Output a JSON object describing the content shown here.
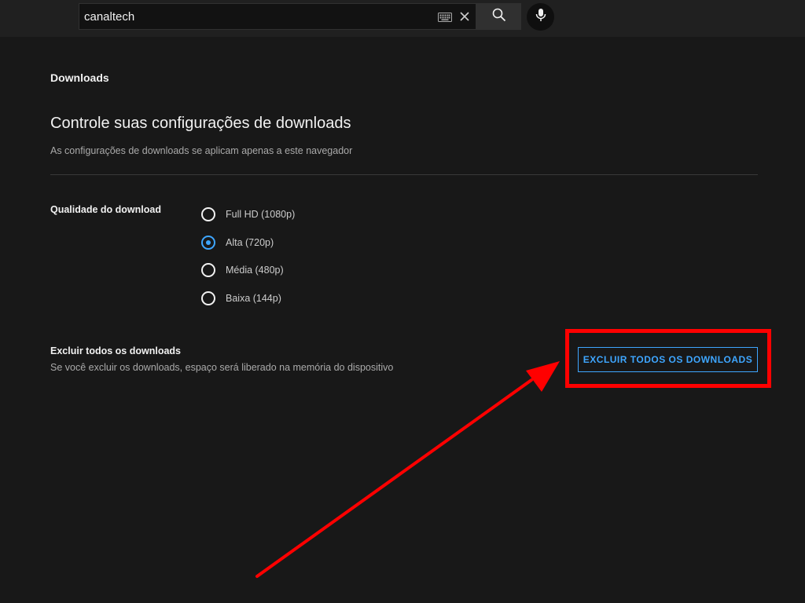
{
  "search": {
    "value": "canaltech",
    "icons": {
      "keyboard": "keyboard-icon",
      "clear": "close-icon",
      "search": "search-icon",
      "mic": "microphone-icon"
    }
  },
  "page": {
    "section_title": "Downloads",
    "title": "Controle suas configurações de downloads",
    "subtitle": "As configurações de downloads se aplicam apenas a este navegador"
  },
  "quality": {
    "label": "Qualidade do download",
    "options": [
      {
        "label": "Full HD (1080p)",
        "selected": false
      },
      {
        "label": "Alta (720p)",
        "selected": true
      },
      {
        "label": "Média (480p)",
        "selected": false
      },
      {
        "label": "Baixa (144p)",
        "selected": false
      }
    ]
  },
  "delete": {
    "title": "Excluir todos os downloads",
    "description": "Se você excluir os downloads, espaço será liberado na memória do dispositivo",
    "button_label": "EXCLUIR TODOS OS DOWNLOADS"
  },
  "colors": {
    "background": "#181818",
    "topbar": "#202020",
    "accent": "#3ea6ff",
    "annotation": "#ff0000"
  }
}
